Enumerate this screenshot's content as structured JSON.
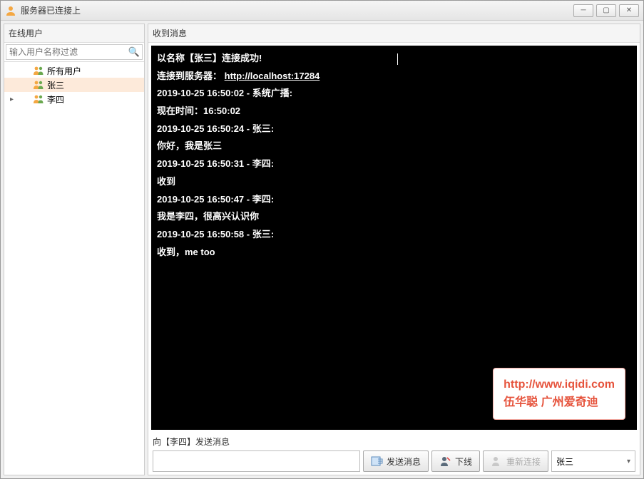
{
  "window": {
    "title": "服务器已连接上"
  },
  "sidebar": {
    "header": "在线用户",
    "search_placeholder": "输入用户名称过滤",
    "items": [
      {
        "label": "所有用户",
        "selected": false,
        "arrow": false
      },
      {
        "label": "张三",
        "selected": true,
        "arrow": false
      },
      {
        "label": "李四",
        "selected": false,
        "arrow": true
      }
    ]
  },
  "main": {
    "header": "收到消息",
    "connect_line_prefix": "以名称【张三】连接成功!",
    "server_line_prefix": "连接到服务器：",
    "server_url": "http://localhost:17284",
    "messages": [
      {
        "header": "2019-10-25 16:50:02 - 系统广播:",
        "body": " 现在时间：16:50:02"
      },
      {
        "header": "2019-10-25 16:50:24 - 张三:",
        "body": " 你好，我是张三"
      },
      {
        "header": "2019-10-25 16:50:31 - 李四:",
        "body": " 收到"
      },
      {
        "header": "2019-10-25 16:50:47 - 李四:",
        "body": " 我是李四，很高兴认识你"
      },
      {
        "header": "2019-10-25 16:50:58 - 张三:",
        "body": " 收到，me too"
      }
    ]
  },
  "watermark": {
    "url": "http://www.iqidi.com",
    "caption": "伍华聪 广州爱奇迪"
  },
  "send": {
    "label": "向【李四】发送消息",
    "send_btn": "发送消息",
    "offline_btn": "下线",
    "reconnect_btn": "重新连接",
    "username": "张三"
  }
}
